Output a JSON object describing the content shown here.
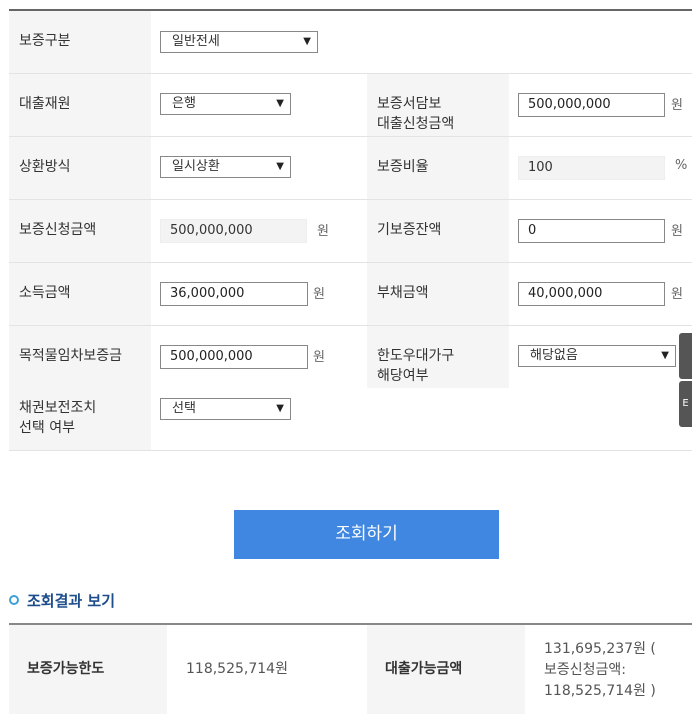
{
  "form": {
    "guarantee_type": {
      "label": "보증구분",
      "value": "일반전세"
    },
    "loan_source": {
      "label": "대출재원",
      "value": "은행"
    },
    "doc_loan_amount": {
      "label_1": "보증서담보",
      "label_2": "대출신청금액",
      "value": "500,000,000",
      "unit": "원"
    },
    "repayment": {
      "label": "상환방식",
      "value": "일시상환"
    },
    "guarantee_ratio": {
      "label": "보증비율",
      "value": "100",
      "unit": "%"
    },
    "guarantee_apply": {
      "label": "보증신청금액",
      "value": "500,000,000",
      "unit": "원"
    },
    "existing_balance": {
      "label": "기보증잔액",
      "value": "0",
      "unit": "원"
    },
    "income": {
      "label": "소득금액",
      "value": "36,000,000",
      "unit": "원"
    },
    "debt": {
      "label": "부채금액",
      "value": "40,000,000",
      "unit": "원"
    },
    "deposit": {
      "label": "목적물임차보증금",
      "value": "500,000,000",
      "unit": "원"
    },
    "preferential": {
      "label_1": "한도우대가구",
      "label_2": "해당여부",
      "value": "해당없음"
    },
    "bond_preserve": {
      "label_1": "채권보전조치",
      "label_2": "선택 여부",
      "value": "선택"
    }
  },
  "side_buttons": [
    "",
    "E"
  ],
  "search_button": "조회하기",
  "results": {
    "title": "조회결과 보기",
    "limit_label": "보증가능한도",
    "limit_value": "118,525,714원",
    "loan_label": "대출가능금액",
    "loan_value_1": "131,695,237원 (",
    "loan_value_2": "보증신청금액:",
    "loan_value_3": "118,525,714원 )"
  }
}
